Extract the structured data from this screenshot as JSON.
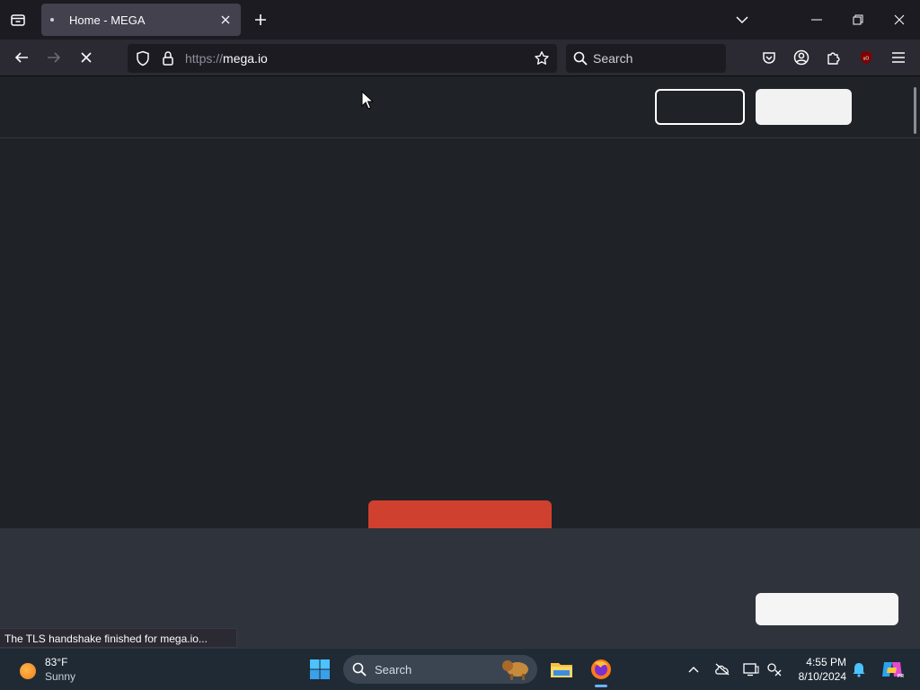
{
  "browser": {
    "tab": {
      "title": "Home - MEGA"
    },
    "url": {
      "scheme": "https://",
      "host": "mega.io"
    },
    "search_placeholder": "Search"
  },
  "page": {
    "status_text": "The TLS handshake finished for mega.io..."
  },
  "taskbar": {
    "weather": {
      "temp": "83°F",
      "condition": "Sunny"
    },
    "search_placeholder": "Search",
    "clock": {
      "time": "4:55 PM",
      "date": "8/10/2024"
    }
  },
  "colors": {
    "page_bg": "#1f2327",
    "footer_bg": "#2f333b",
    "red_button": "#d0402e",
    "taskbar_bg": "#1f2a35"
  }
}
